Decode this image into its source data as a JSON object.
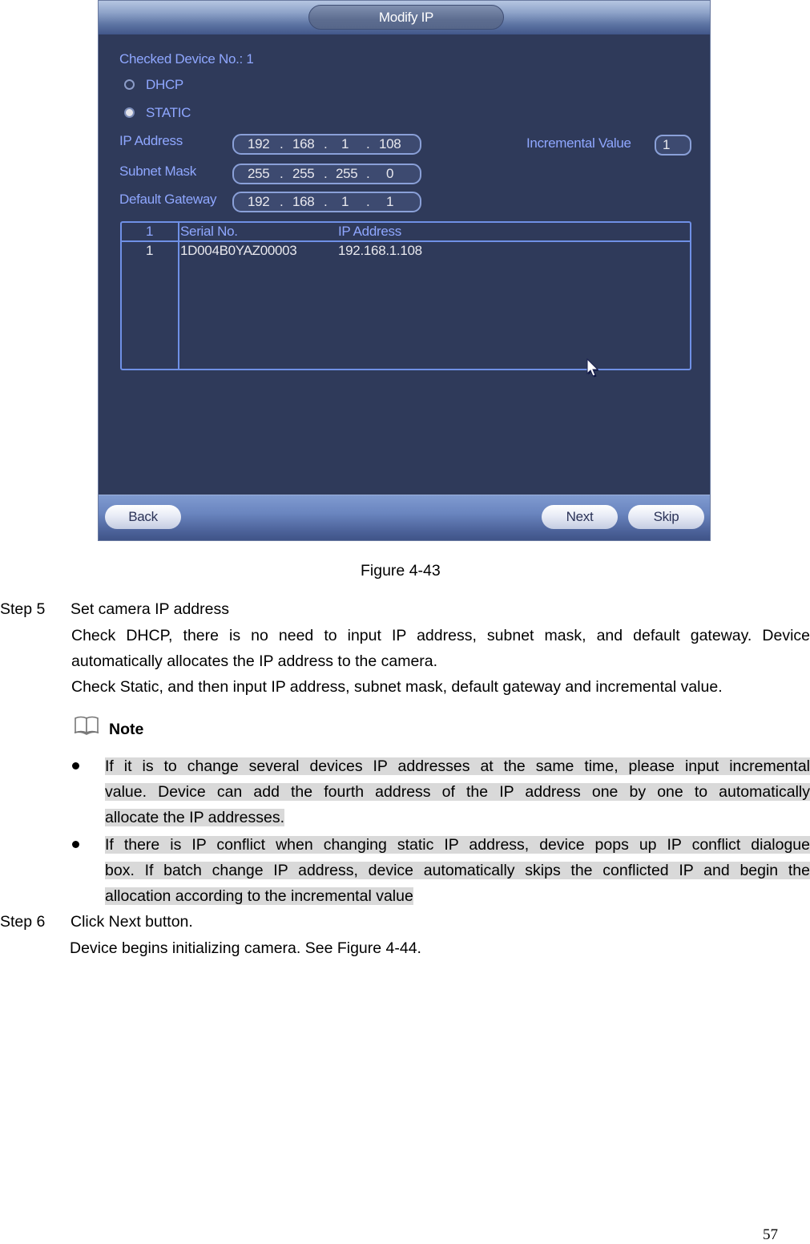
{
  "dialog": {
    "title": "Modify IP",
    "checked_device_label": "Checked Device No.: 1",
    "mode_options": [
      {
        "label": "DHCP",
        "selected": false
      },
      {
        "label": "STATIC",
        "selected": true
      }
    ],
    "fields": {
      "ip_address": {
        "label": "IP Address",
        "octets": [
          "192",
          "168",
          "1",
          "108"
        ]
      },
      "subnet_mask": {
        "label": "Subnet Mask",
        "octets": [
          "255",
          "255",
          "255",
          "0"
        ]
      },
      "default_gateway": {
        "label": "Default Gateway",
        "octets": [
          "192",
          "168",
          "1",
          "1"
        ]
      }
    },
    "incremental_value": {
      "label": "Incremental Value",
      "value": "1"
    },
    "table": {
      "headers": [
        "1",
        "Serial No.",
        "IP Address"
      ],
      "rows": [
        {
          "index": "1",
          "serial": "1D004B0YAZ00003",
          "ip": "192.168.1.108"
        }
      ]
    },
    "buttons": {
      "back": "Back",
      "next": "Next",
      "skip": "Skip"
    },
    "colors": {
      "background": "#2f3a5a",
      "label": "#8fa7ff",
      "border": "#6f90e6"
    }
  },
  "document": {
    "caption": "Figure 4-43",
    "step5": {
      "label": "Step 5",
      "title": "Set camera IP address",
      "lines": [
        "Check DHCP, there is no need to input IP address, subnet mask, and default gateway. Device",
        "automatically allocates the IP address to the camera.",
        "Check Static, and then input IP address, subnet mask, default gateway and incremental value."
      ]
    },
    "note": {
      "label": "Note",
      "bullets": [
        [
          "If it is to change several devices IP addresses at the same time, please input incremental",
          "value. Device can add the fourth address of the IP address one by one to automatically",
          "allocate the IP addresses. "
        ],
        [
          "If there is IP conflict when changing static IP address, device pops up IP conflict dialogue",
          "box. If batch change IP address, device automatically skips the conflicted IP and begin the",
          "allocation according to the incremental value "
        ]
      ]
    },
    "step6": {
      "label": "Step 6",
      "title": "Click Next button.",
      "lines": [
        "Device begins initializing camera. See Figure 4-44."
      ]
    },
    "page_number": "57"
  }
}
